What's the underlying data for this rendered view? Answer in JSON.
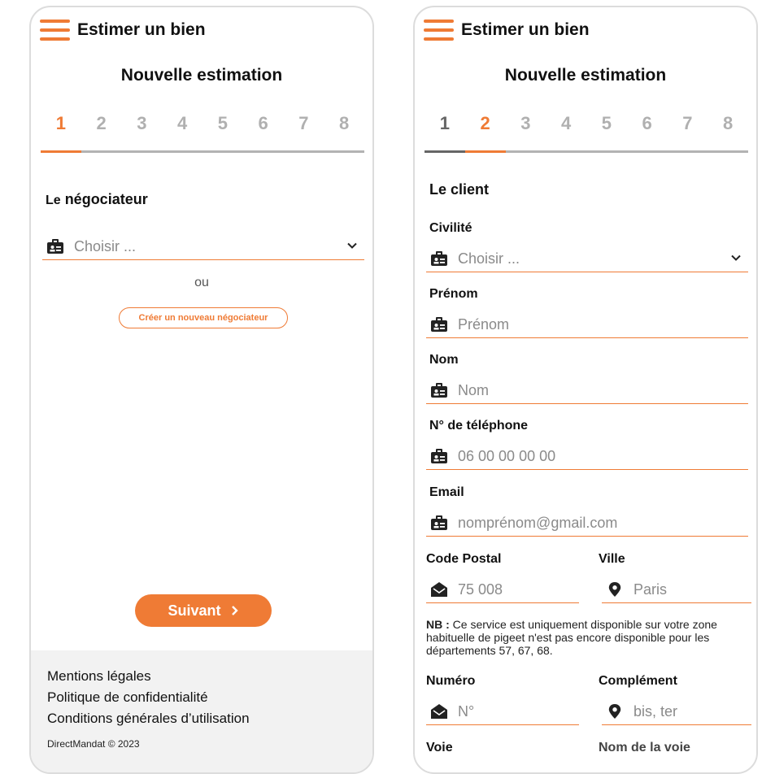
{
  "app_title": "Estimer un bien",
  "page_title": "Nouvelle estimation",
  "steps": [
    "1",
    "2",
    "3",
    "4",
    "5",
    "6",
    "7",
    "8"
  ],
  "colors": {
    "accent": "#ef7b35",
    "track": "#b3b3b3",
    "done": "#666666"
  },
  "screen1": {
    "active_step": 1,
    "section_title_prefix": "Le",
    "section_title_main": "négociateur",
    "negotiator_select": {
      "placeholder": "Choisir ..."
    },
    "or_text": "ou",
    "create_button": "Créer un nouveau négociateur",
    "next_button": "Suivant",
    "footer": {
      "links": [
        "Mentions légales",
        "Politique de confidentialité",
        "Conditions générales d’utilisation"
      ],
      "copyright": "DirectMandat © 2023"
    }
  },
  "screen2": {
    "active_step": 2,
    "section_title": "Le client",
    "fields": {
      "civility": {
        "label": "Civilité",
        "placeholder": "Choisir ..."
      },
      "firstname": {
        "label": "Prénom",
        "placeholder": "Prénom"
      },
      "lastname": {
        "label": "Nom",
        "placeholder": "Nom"
      },
      "phone": {
        "label": "N° de téléphone",
        "placeholder": "06 00 00 00 00"
      },
      "email": {
        "label": "Email",
        "placeholder": "nomprénom@gmail.com"
      },
      "postal_code": {
        "label": "Code Postal",
        "placeholder": "75 008"
      },
      "city": {
        "label": "Ville",
        "placeholder": "Paris"
      },
      "number": {
        "label": "Numéro",
        "placeholder": "N°"
      },
      "complement": {
        "label": "Complément",
        "placeholder": "bis, ter"
      },
      "street_type": {
        "label": "Voie"
      },
      "street_name": {
        "label": "Nom de la voie"
      }
    },
    "note_bold": "NB :",
    "note_text": " Ce service est uniquement disponible sur votre zone habituelle de pigeet n'est pas encore disponible pour les départements 57, 67, 68."
  }
}
